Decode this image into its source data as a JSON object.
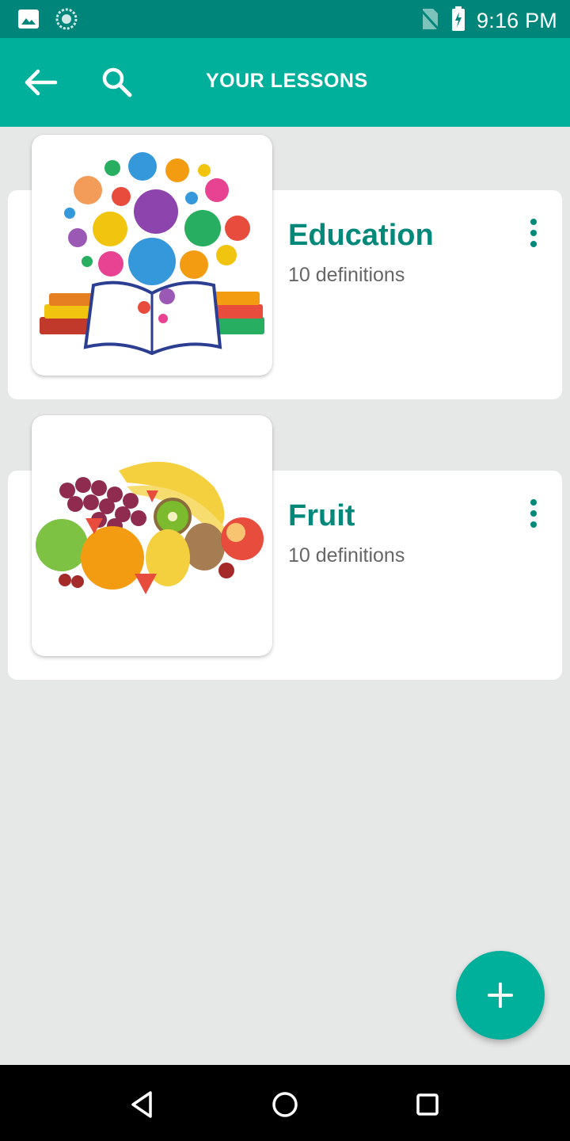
{
  "status_bar": {
    "time": "9:16 PM",
    "icons": [
      "image-icon",
      "sync-icon",
      "no-sim-icon",
      "battery-charging-icon"
    ]
  },
  "app_bar": {
    "title": "YOUR LESSONS",
    "back_icon": "arrow-back-icon",
    "search_icon": "search-icon"
  },
  "lessons": [
    {
      "title": "Education",
      "subtitle": "10 definitions",
      "menu_icon": "more-vert-icon"
    },
    {
      "title": "Fruit",
      "subtitle": "10 definitions",
      "menu_icon": "more-vert-icon"
    }
  ],
  "fab": {
    "icon": "add-icon"
  },
  "nav_bar": {
    "icons": [
      "back-triangle-icon",
      "home-circle-icon",
      "recents-square-icon"
    ]
  },
  "colors": {
    "status_bar": "#00857a",
    "app_bar": "#00b09b",
    "accent_text": "#00897b",
    "background": "#e6e7e7"
  }
}
